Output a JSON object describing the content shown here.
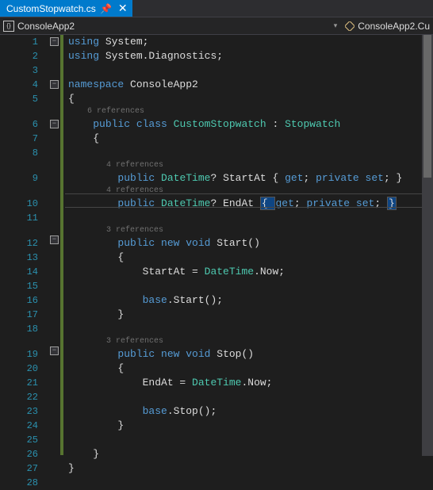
{
  "tab": {
    "filename": "CustomStopwatch.cs",
    "pin_glyph": "📌",
    "close_glyph": "✕"
  },
  "navbar": {
    "left_label": "ConsoleApp2",
    "right_label": "ConsoleApp2.Cu",
    "ns_glyph": "{}"
  },
  "refs": {
    "r6": "6 references",
    "r4a": "4 references",
    "r4b": "4 references",
    "r3a": "3 references",
    "r3b": "3 references"
  },
  "code": {
    "l1_kw1": "using",
    "l1_ns": " System;",
    "l2_kw1": "using",
    "l2_ns": " System.Diagnostics;",
    "l4_kw1": "namespace",
    "l4_ns": " ConsoleApp2",
    "l5": "{",
    "l6_kw1": "public",
    "l6_kw2": " class",
    "l6_type": " CustomStopwatch",
    "l6_colon": " : ",
    "l6_base": "Stopwatch",
    "l7": "{",
    "l9_kw1": "public",
    "l9_type": " DateTime",
    "l9_q": "?",
    "l9_name": " StartAt ",
    "l9_acc1": "{ ",
    "l9_get": "get",
    "l9_sc1": "; ",
    "l9_priv": "private",
    "l9_set": " set",
    "l9_sc2": "; ",
    "l9_acc2": "}",
    "l10_kw1": "public",
    "l10_type": " DateTime",
    "l10_q": "?",
    "l10_name": " EndAt ",
    "l10_acc1": "{ ",
    "l10_get": "get",
    "l10_sc1": "; ",
    "l10_priv": "private",
    "l10_set": " set",
    "l10_sc2": "; ",
    "l10_acc2": "}",
    "l12_kw1": "public",
    "l12_kw2": " new",
    "l12_kw3": " void",
    "l12_name": " Start()",
    "l13": "{",
    "l14_a": "StartAt = ",
    "l14_type": "DateTime",
    "l14_b": ".Now;",
    "l16_a": "base",
    "l16_b": ".Start();",
    "l17": "}",
    "l19_kw1": "public",
    "l19_kw2": " new",
    "l19_kw3": " void",
    "l19_name": " Stop()",
    "l20": "{",
    "l21_a": "EndAt = ",
    "l21_type": "DateTime",
    "l21_b": ".Now;",
    "l23_a": "base",
    "l23_b": ".Stop();",
    "l24": "}",
    "l26": "}",
    "l27": "}"
  },
  "line_numbers": [
    "1",
    "2",
    "3",
    "4",
    "5",
    "6",
    "7",
    "8",
    "9",
    "10",
    "11",
    "12",
    "13",
    "14",
    "15",
    "16",
    "17",
    "18",
    "19",
    "20",
    "21",
    "22",
    "23",
    "24",
    "25",
    "26",
    "27",
    "28"
  ]
}
